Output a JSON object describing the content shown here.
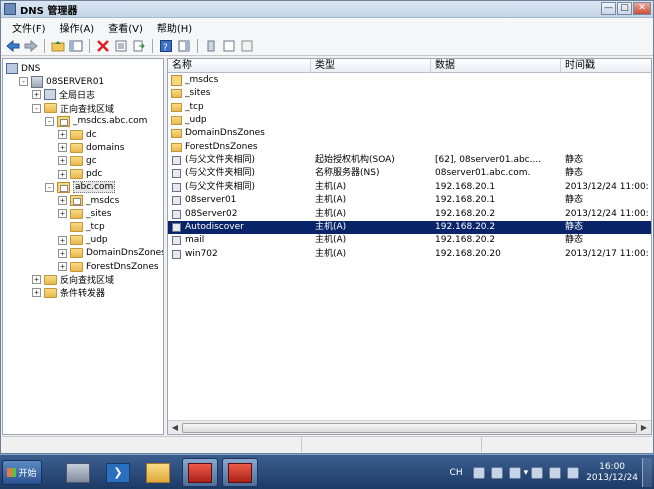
{
  "window": {
    "title": "DNS 管理器",
    "controls": {
      "minimize": "—",
      "maximize": "□",
      "close": "✕"
    }
  },
  "menu": [
    "文件(F)",
    "操作(A)",
    "查看(V)",
    "帮助(H)"
  ],
  "tree": [
    {
      "label": "DNS",
      "indent": 0,
      "expander": "",
      "icon": "dns"
    },
    {
      "label": "08SERVER01",
      "indent": 1,
      "expander": "-",
      "icon": "server"
    },
    {
      "label": "全局日志",
      "indent": 2,
      "expander": "+",
      "icon": "log"
    },
    {
      "label": "正向查找区域",
      "indent": 2,
      "expander": "-",
      "icon": "folder"
    },
    {
      "label": "_msdcs.abc.com",
      "indent": 3,
      "expander": "-",
      "icon": "zone"
    },
    {
      "label": "dc",
      "indent": 4,
      "expander": "+",
      "icon": "folder"
    },
    {
      "label": "domains",
      "indent": 4,
      "expander": "+",
      "icon": "folder"
    },
    {
      "label": "gc",
      "indent": 4,
      "expander": "+",
      "icon": "folder"
    },
    {
      "label": "pdc",
      "indent": 4,
      "expander": "+",
      "icon": "folder"
    },
    {
      "label": "abc.com",
      "indent": 3,
      "expander": "-",
      "icon": "zone",
      "selected": true
    },
    {
      "label": "_msdcs",
      "indent": 4,
      "expander": "+",
      "icon": "zone"
    },
    {
      "label": "_sites",
      "indent": 4,
      "expander": "+",
      "icon": "folder"
    },
    {
      "label": "_tcp",
      "indent": 4,
      "expander": "",
      "icon": "folder"
    },
    {
      "label": "_udp",
      "indent": 4,
      "expander": "+",
      "icon": "folder"
    },
    {
      "label": "DomainDnsZones",
      "indent": 4,
      "expander": "+",
      "icon": "folder"
    },
    {
      "label": "ForestDnsZones",
      "indent": 4,
      "expander": "+",
      "icon": "folder"
    },
    {
      "label": "反向查找区域",
      "indent": 2,
      "expander": "+",
      "icon": "folder"
    },
    {
      "label": "条件转发器",
      "indent": 2,
      "expander": "+",
      "icon": "folder"
    }
  ],
  "columns": [
    "名称",
    "类型",
    "数据",
    "时间戳"
  ],
  "records": [
    {
      "name": "_msdcs",
      "type": "",
      "data": "",
      "timestamp": "",
      "icon": "msdcs"
    },
    {
      "name": "_sites",
      "type": "",
      "data": "",
      "timestamp": "",
      "icon": "folder"
    },
    {
      "name": "_tcp",
      "type": "",
      "data": "",
      "timestamp": "",
      "icon": "folder"
    },
    {
      "name": "_udp",
      "type": "",
      "data": "",
      "timestamp": "",
      "icon": "folder"
    },
    {
      "name": "DomainDnsZones",
      "type": "",
      "data": "",
      "timestamp": "",
      "icon": "folder"
    },
    {
      "name": "ForestDnsZones",
      "type": "",
      "data": "",
      "timestamp": "",
      "icon": "folder"
    },
    {
      "name": "(与父文件夹相同)",
      "type": "起始授权机构(SOA)",
      "data": "[62], 08server01.abc....",
      "timestamp": "静态",
      "icon": "record"
    },
    {
      "name": "(与父文件夹相同)",
      "type": "名称服务器(NS)",
      "data": "08server01.abc.com.",
      "timestamp": "静态",
      "icon": "record"
    },
    {
      "name": "(与父文件夹相同)",
      "type": "主机(A)",
      "data": "192.168.20.1",
      "timestamp": "2013/12/24 11:00:",
      "icon": "record"
    },
    {
      "name": "08server01",
      "type": "主机(A)",
      "data": "192.168.20.1",
      "timestamp": "静态",
      "icon": "record"
    },
    {
      "name": "08Server02",
      "type": "主机(A)",
      "data": "192.168.20.2",
      "timestamp": "2013/12/24 11:00:",
      "icon": "record"
    },
    {
      "name": "Autodiscover",
      "type": "主机(A)",
      "data": "192.168.20.2",
      "timestamp": "静态",
      "icon": "record",
      "selected": true
    },
    {
      "name": "mail",
      "type": "主机(A)",
      "data": "192.168.20.2",
      "timestamp": "静态",
      "icon": "record"
    },
    {
      "name": "win702",
      "type": "主机(A)",
      "data": "192.168.20.20",
      "timestamp": "2013/12/17 11:00:",
      "icon": "record"
    }
  ],
  "taskbar": {
    "start_label": "开始",
    "lang": "CH",
    "time": "16:00",
    "date": "2013/12/24"
  }
}
